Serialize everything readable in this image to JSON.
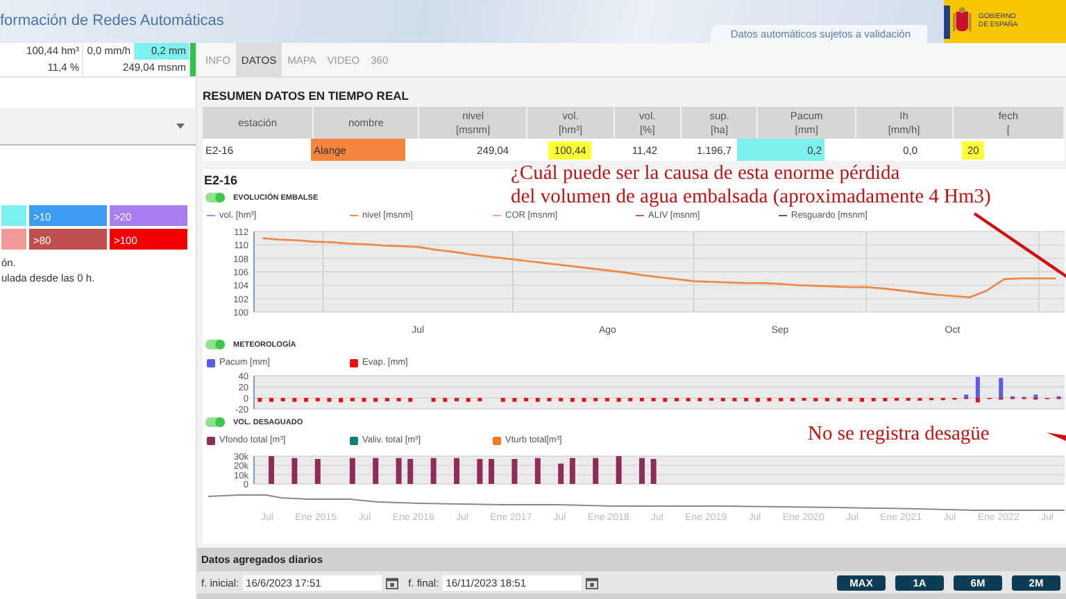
{
  "header": {
    "title": "formación de Redes Automáticas",
    "notice": "Datos automáticos sujetos a validación",
    "logo_text": "GOBIERNO DE ESPAÑA"
  },
  "left_panel": {
    "stats": [
      {
        "volume": "100,44 hm³",
        "intensity": "0,0 mm/h",
        "rain": "0,2 mm"
      },
      {
        "percent": "11,4 %",
        "level": "249,04 msnm"
      }
    ],
    "legend": [
      {
        "color": "#7ef0ee"
      },
      {
        "text": ">10",
        "color": "#3b9cf2"
      },
      {
        "text": ">20",
        "color": "#a97ef0"
      },
      {
        "color": "#f29a98"
      },
      {
        "text": ">80",
        "color": "#c0504d"
      },
      {
        "text": ">100",
        "color": "#f00000"
      }
    ],
    "notes": [
      "ón.",
      "ulada desde las 0 h."
    ]
  },
  "tabs": [
    {
      "label": "INFO",
      "selected": false
    },
    {
      "label": "DATOS",
      "selected": true
    },
    {
      "label": "MAPA",
      "selected": false
    },
    {
      "label": "VIDEO",
      "selected": false
    },
    {
      "label": "360",
      "selected": false
    }
  ],
  "summary": {
    "title": "RESUMEN DATOS EN TIEMPO REAL",
    "columns": [
      {
        "name": "estación"
      },
      {
        "name": "nombre"
      },
      {
        "name": "nivel",
        "unit": "[msnm]"
      },
      {
        "name": "vol.",
        "unit": "[hm³]"
      },
      {
        "name": "vol.",
        "unit": "[%]"
      },
      {
        "name": "sup.",
        "unit": "[ha]"
      },
      {
        "name": "Pacum",
        "unit": "[mm]"
      },
      {
        "name": "Ih",
        "unit": "[mm/h]"
      },
      {
        "name": "fech",
        "unit": "["
      }
    ],
    "row": [
      {
        "text": "E2-16",
        "kind": "plain"
      },
      {
        "text": "Alange",
        "kind": "fill",
        "color": "#f5843c"
      },
      {
        "text": "249,04",
        "kind": "plain"
      },
      {
        "text": "100,44",
        "kind": "mark",
        "color": "#ffff33"
      },
      {
        "text": "11,42",
        "kind": "plain"
      },
      {
        "text": "1.196,7",
        "kind": "plain"
      },
      {
        "text": "0,2",
        "kind": "fill",
        "color": "#7ef0ee"
      },
      {
        "text": "0,0",
        "kind": "plain"
      },
      {
        "text": "20",
        "kind": "mark",
        "color": "#ffff33"
      }
    ]
  },
  "station": "E2-16",
  "sections": [
    {
      "title": "EVOLUCIÓN EMBALSE",
      "on": true,
      "chart_data": {
        "type": "line",
        "categories": [
          null,
          null,
          null,
          null,
          null,
          null,
          null,
          null,
          null,
          "Jul",
          null,
          null,
          null,
          null,
          null,
          null,
          null,
          null,
          null,
          null,
          "Ago",
          null,
          null,
          null,
          null,
          null,
          null,
          null,
          null,
          null,
          "Sep",
          null,
          null,
          null,
          null,
          null,
          null,
          null,
          null,
          null,
          "Oct",
          null,
          null,
          null,
          null,
          null,
          null
        ],
        "series": [
          {
            "name": "vol. [hm³]",
            "color": "#6f9fd8",
            "values": [
              null,
              null,
              null,
              null,
              null,
              null,
              null,
              null,
              null,
              null,
              null,
              null,
              null,
              null,
              null,
              null,
              null,
              null,
              null,
              null,
              null,
              null,
              null,
              null,
              null,
              null,
              null,
              null,
              null,
              null,
              null,
              null,
              null,
              null,
              null,
              null,
              null,
              null,
              null,
              null,
              null,
              null,
              null,
              null,
              null,
              null,
              null
            ]
          },
          {
            "name": "nivel [msnm]",
            "color": "#ec8a4a",
            "values": [
              111,
              110.8,
              110.7,
              110.5,
              110.4,
              110.2,
              110.1,
              109.9,
              109.8,
              109.7,
              109.3,
              109,
              108.6,
              108.3,
              108,
              107.7,
              107.4,
              107.1,
              106.8,
              106.5,
              106.2,
              105.9,
              105.5,
              105.2,
              104.9,
              104.6,
              104.5,
              104.4,
              104.3,
              104.3,
              104.2,
              104,
              103.9,
              103.8,
              103.7,
              103.7,
              103.5,
              103.2,
              102.9,
              102.6,
              102.4,
              102.2,
              103.2,
              104.9,
              105,
              105,
              105
            ]
          },
          {
            "name": "COR [msnm]",
            "color": "#f4a0a0",
            "values": [
              null,
              null,
              null,
              null,
              null,
              null,
              null,
              null,
              null,
              null,
              null,
              null,
              null,
              null,
              null,
              null,
              null,
              null,
              null,
              null,
              null,
              null,
              null,
              null,
              null,
              null,
              null,
              null,
              null,
              null,
              null,
              null,
              null,
              null,
              null,
              null,
              null,
              null,
              null,
              null,
              null,
              null,
              null,
              null,
              null,
              null,
              null
            ]
          },
          {
            "name": "ALIV [msnm]",
            "color": "#c0509a",
            "values": [
              null,
              null,
              null,
              null,
              null,
              null,
              null,
              null,
              null,
              null,
              null,
              null,
              null,
              null,
              null,
              null,
              null,
              null,
              null,
              null,
              null,
              null,
              null,
              null,
              null,
              null,
              null,
              null,
              null,
              null,
              null,
              null,
              null,
              null,
              null,
              null,
              null,
              null,
              null,
              null,
              null,
              null,
              null,
              null,
              null,
              null,
              null
            ]
          },
          {
            "name": "Resguardo [msnm]",
            "color": "#4a6a4a",
            "values": [
              null,
              null,
              null,
              null,
              null,
              null,
              null,
              null,
              null,
              null,
              null,
              null,
              null,
              null,
              null,
              null,
              null,
              null,
              null,
              null,
              null,
              null,
              null,
              null,
              null,
              null,
              null,
              null,
              null,
              null,
              null,
              null,
              null,
              null,
              null,
              null,
              null,
              null,
              null,
              null,
              null,
              null,
              null,
              null,
              null,
              null,
              null
            ]
          }
        ],
        "grid": true,
        "ylim": [
          100,
          112
        ],
        "yticks": [
          100,
          102,
          104,
          106,
          108,
          110,
          112
        ]
      }
    },
    {
      "title": "METEOROLOGÍA",
      "on": true,
      "chart_data": {
        "type": "bar",
        "categories": [
          null,
          null,
          null,
          null,
          null,
          null,
          null,
          null,
          null,
          null,
          null,
          null,
          null,
          null,
          null,
          null,
          null,
          null,
          null,
          null,
          null,
          null,
          null,
          null,
          null,
          null,
          null,
          null,
          null,
          null,
          null,
          null,
          null,
          null,
          null,
          null,
          null,
          null,
          null,
          null,
          null,
          null,
          null,
          null,
          null,
          null,
          null,
          null,
          null,
          null,
          null,
          null,
          null,
          null,
          null,
          null,
          null,
          null,
          null,
          null,
          null,
          null,
          null,
          null,
          null,
          null,
          null,
          null,
          null,
          null
        ],
        "series": [
          {
            "name": "Pacum [mm]",
            "color": "#5b5be8",
            "values": [
              null,
              null,
              null,
              null,
              null,
              null,
              null,
              null,
              null,
              null,
              null,
              null,
              null,
              null,
              null,
              null,
              null,
              null,
              null,
              null,
              null,
              null,
              null,
              null,
              null,
              null,
              null,
              null,
              null,
              null,
              null,
              null,
              null,
              null,
              null,
              null,
              null,
              null,
              null,
              null,
              null,
              null,
              null,
              null,
              null,
              null,
              null,
              null,
              null,
              null,
              null,
              null,
              null,
              null,
              null,
              null,
              null,
              null,
              null,
              null,
              null,
              6,
              38,
              null,
              36,
              3,
              2,
              6,
              null,
              3
            ]
          },
          {
            "name": "Evap. [mm]",
            "color": "#e81010",
            "values": [
              -7,
              -7,
              -6,
              -7,
              -7,
              -6,
              -7,
              -8,
              -6,
              -7,
              -7,
              -6,
              -6,
              -7,
              null,
              -7,
              -7,
              -6,
              -7,
              -6,
              null,
              -7,
              -7,
              -6,
              -7,
              -6,
              -6,
              -7,
              -7,
              -6,
              -6,
              -7,
              -6,
              -6,
              -6,
              -7,
              -6,
              -6,
              -6,
              -5,
              -6,
              -6,
              -6,
              -7,
              -6,
              -6,
              -6,
              -5,
              -6,
              -6,
              -6,
              -6,
              -7,
              -6,
              -6,
              -5,
              -5,
              -5,
              -4,
              -4,
              -3,
              -2,
              -8,
              -2,
              -3,
              -2,
              -2,
              -3,
              -2,
              -2
            ]
          }
        ],
        "grid": true,
        "ylim": [
          -20,
          40
        ],
        "yticks": [
          -20,
          0,
          20,
          40
        ]
      }
    },
    {
      "title": "VOL. DESAGUADO",
      "on": true,
      "chart_data": {
        "type": "bar",
        "categories": [
          null,
          null,
          null,
          null,
          null,
          null,
          null,
          null,
          null,
          null,
          null,
          null,
          null,
          null,
          null,
          null,
          null,
          null,
          null,
          null,
          null,
          null,
          null,
          null,
          null,
          null,
          null,
          null,
          null,
          null,
          null,
          null,
          null,
          null,
          null,
          null,
          null,
          null,
          null,
          null,
          null,
          null,
          null,
          null,
          null,
          null,
          null,
          null,
          null,
          null,
          null,
          null,
          null,
          null,
          null,
          null,
          null,
          null,
          null,
          null,
          null,
          null,
          null,
          null,
          null,
          null,
          null,
          null,
          null,
          null
        ],
        "series": [
          {
            "name": "Vfondo total [m³]",
            "color": "#8e2d5a",
            "values": [
              null,
              30000,
              null,
              28000,
              null,
              27000,
              null,
              null,
              28000,
              null,
              28000,
              null,
              28000,
              27000,
              null,
              28000,
              null,
              28000,
              null,
              27000,
              27000,
              null,
              27000,
              null,
              28000,
              null,
              22000,
              28000,
              null,
              28000,
              null,
              30000,
              null,
              28000,
              27000,
              null,
              null,
              null,
              null,
              null,
              null,
              null,
              null,
              null,
              null,
              null,
              null,
              null,
              null,
              null,
              null,
              null,
              null,
              null,
              null,
              null,
              null,
              null,
              null,
              null,
              null,
              null,
              null,
              null,
              null,
              null,
              null,
              null,
              null,
              null
            ]
          },
          {
            "name": "Valiv. total [m³]",
            "color": "#107f7a",
            "values": [
              null,
              null,
              null,
              null,
              null,
              null,
              null,
              null,
              null,
              null,
              null,
              null,
              null,
              null,
              null,
              null,
              null,
              null,
              null,
              null,
              null,
              null,
              null,
              null,
              null,
              null,
              null,
              null,
              null,
              null,
              null,
              null,
              null,
              null,
              null,
              null,
              null,
              null,
              null,
              null,
              null,
              null,
              null,
              null,
              null,
              null,
              null,
              null,
              null,
              null,
              null,
              null,
              null,
              null,
              null,
              null,
              null,
              null,
              null,
              null,
              null,
              null,
              null,
              null,
              null,
              null,
              null,
              null,
              null,
              null
            ]
          },
          {
            "name": "Vturb total[m³]",
            "color": "#f07b22",
            "values": [
              null,
              null,
              null,
              null,
              null,
              null,
              null,
              null,
              null,
              null,
              null,
              null,
              null,
              null,
              null,
              null,
              null,
              null,
              null,
              null,
              null,
              null,
              null,
              null,
              null,
              null,
              null,
              null,
              null,
              null,
              null,
              null,
              null,
              null,
              null,
              null,
              null,
              null,
              null,
              null,
              null,
              null,
              null,
              null,
              null,
              null,
              null,
              null,
              null,
              null,
              null,
              null,
              null,
              null,
              null,
              null,
              null,
              null,
              null,
              null,
              null,
              null,
              null,
              null,
              null,
              null,
              null,
              null,
              null,
              null
            ]
          }
        ],
        "grid": true,
        "ylim": [
          0,
          30000
        ],
        "yticks": [
          {
            "value": 0,
            "label": "0"
          },
          {
            "value": 10000,
            "label": "10k"
          },
          {
            "value": 20000,
            "label": "20k"
          },
          {
            "value": 30000,
            "label": "30k"
          }
        ]
      }
    }
  ],
  "navigator": {
    "labels": [
      "Jul",
      "Ene 2015",
      "Jul",
      "Ene 2016",
      "Jul",
      "Ene 2017",
      "Jul",
      "Ene 2018",
      "Jul",
      "Ene 2019",
      "Jul",
      "Ene 2020",
      "Jul",
      "Ene 2021",
      "Jul",
      "Ene 2022",
      "Jul"
    ]
  },
  "footer": {
    "title": "Datos agregados diarios",
    "start_label": "f. inicial:",
    "start_value": "16/6/2023 17:51",
    "end_label": "f. final:",
    "end_value": "16/11/2023 18:51",
    "buttons": [
      "MAX",
      "1A",
      "6M",
      "2M"
    ]
  },
  "annotations": {
    "question": [
      "¿Cuál puede ser la causa de esta enorme pérdida",
      "del volumen de agua embalsada (aproximadamente 4 Hm3)"
    ],
    "note": "No se registra desagüe"
  }
}
